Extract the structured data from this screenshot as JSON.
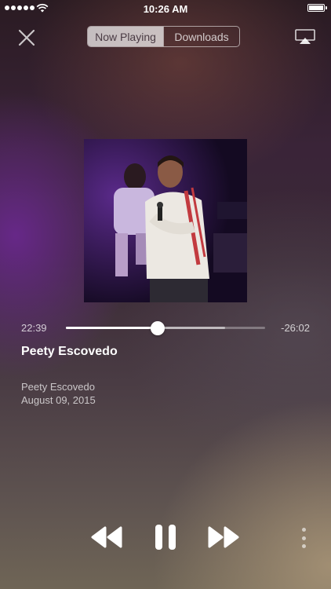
{
  "status_bar": {
    "time": "10:26 AM",
    "signal_icon": "signal-dots-icon",
    "wifi_icon": "wifi-icon",
    "battery_icon": "battery-icon",
    "battery_level": 1.0
  },
  "nav": {
    "close_icon": "close-icon",
    "tabs": [
      {
        "label": "Now Playing",
        "active": true
      },
      {
        "label": "Downloads",
        "active": false
      }
    ],
    "airplay_icon": "airplay-icon"
  },
  "player": {
    "artwork": "artwork-image",
    "elapsed": "22:39",
    "remaining": "-26:02",
    "progress": 0.46,
    "buffered": 0.8,
    "title": "Peety Escovedo",
    "artist": "Peety Escovedo",
    "date": "August 09, 2015"
  },
  "controls": {
    "rewind_icon": "rewind-icon",
    "pause_icon": "pause-icon",
    "forward_icon": "fast-forward-icon",
    "more_icon": "more-vertical-icon"
  },
  "colors": {
    "accent": "#ffffff",
    "segment_active_bg": "#bdb5b9",
    "segment_active_text": "#4a3b44"
  }
}
